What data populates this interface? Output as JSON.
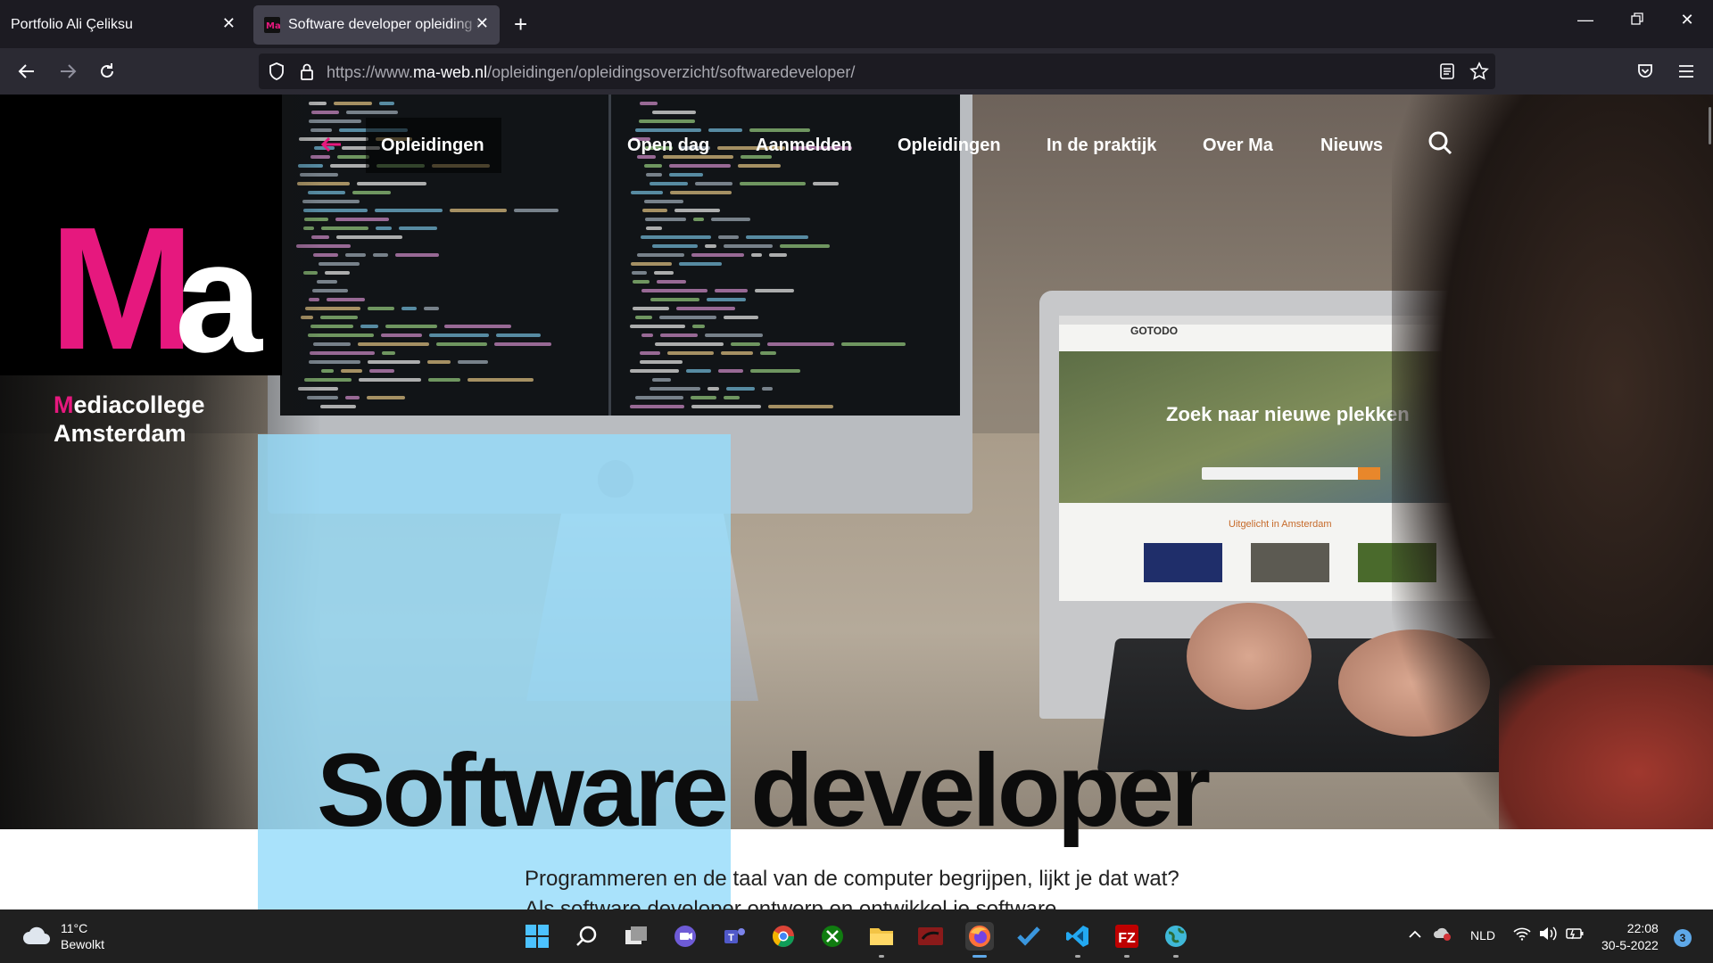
{
  "browser": {
    "tabs": [
      {
        "label": "Portfolio Ali Çeliksu",
        "active": false
      },
      {
        "label": "Software developer opleiding n",
        "active": true
      }
    ],
    "favicon_text": "Ma",
    "url_prefix": "https://www.",
    "url_domain": "ma-web.nl",
    "url_path": "/opleidingen/opleidingsoverzicht/softwaredeveloper/"
  },
  "site": {
    "logo": {
      "m": "M",
      "a": "a",
      "sub_first": "M",
      "sub_rest": "ediacollege",
      "sub_line2": "Amsterdam"
    },
    "nav": {
      "back_label": "Opleidingen",
      "items": [
        "Open dag",
        "Aanmelden",
        "Opleidingen",
        "In de praktijk",
        "Over Ma",
        "Nieuws"
      ]
    },
    "hero_title": "Software developer",
    "intro_line1": "Programmeren en de taal van de computer begrijpen, lijkt je dat wat?",
    "intro_line2": "Als software developer ontwerp en ontwikkel je software.",
    "laptop_screen": {
      "brand": "GOTODO",
      "headline": "Zoek naar nieuwe plekken",
      "subheading": "Uitgelicht in Amsterdam"
    },
    "accent_color": "#e6187e"
  },
  "taskbar": {
    "weather": {
      "temp": "11°C",
      "condition": "Bewolkt"
    },
    "apps": [
      "start",
      "search",
      "task-view",
      "meet",
      "teams",
      "chrome",
      "xbox",
      "file-explorer",
      "app-red",
      "firefox",
      "todo",
      "vscode",
      "filezilla",
      "app-globe"
    ],
    "language": "NLD",
    "time": "22:08",
    "date": "30-5-2022",
    "notifications": "3"
  }
}
